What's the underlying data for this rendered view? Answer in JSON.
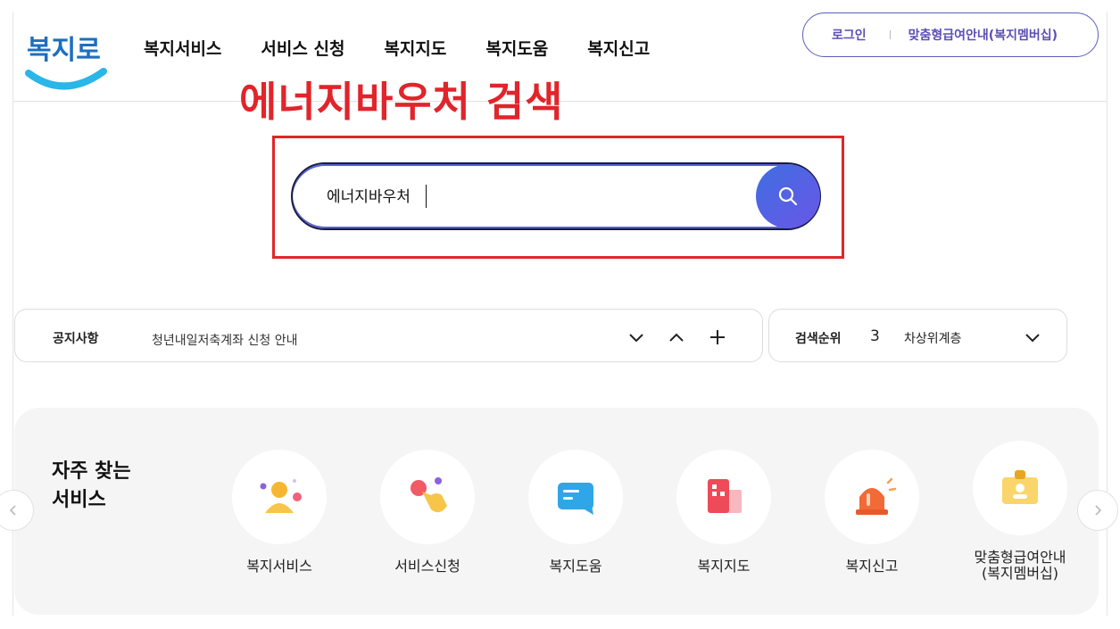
{
  "header": {
    "logo_text": "복지로",
    "nav": [
      "복지서비스",
      "서비스 신청",
      "복지지도",
      "복지도움",
      "복지신고"
    ],
    "login_label": "로그인",
    "membership_label": "맞춤형급여안내(복지멤버십)"
  },
  "annotation": {
    "title": "에너지바우처 검색",
    "color": "#e0252b"
  },
  "search": {
    "value": "에너지바우처",
    "button_icon": "search-icon"
  },
  "notice": {
    "label": "공지사항",
    "text": "청년내일저축계좌 신청 안내",
    "controls": [
      "chevron-down-icon",
      "chevron-up-icon",
      "plus-icon"
    ]
  },
  "rank": {
    "label": "검색순위",
    "number": "3",
    "keyword": "차상위계층"
  },
  "services": {
    "title_line1": "자주 찾는",
    "title_line2": "서비스",
    "items": [
      {
        "label": "복지서비스",
        "icon": "person-icon"
      },
      {
        "label": "서비스신청",
        "icon": "hand-pointer-icon"
      },
      {
        "label": "복지도움",
        "icon": "message-icon"
      },
      {
        "label": "복지지도",
        "icon": "building-icon"
      },
      {
        "label": "복지신고",
        "icon": "alarm-siren-icon"
      },
      {
        "label": "맞춤형급여안내\n(복지멤버십)",
        "icon": "id-card-icon"
      }
    ]
  },
  "colors": {
    "accent": "#5a4fb5",
    "search_button": "#4f66e2"
  }
}
